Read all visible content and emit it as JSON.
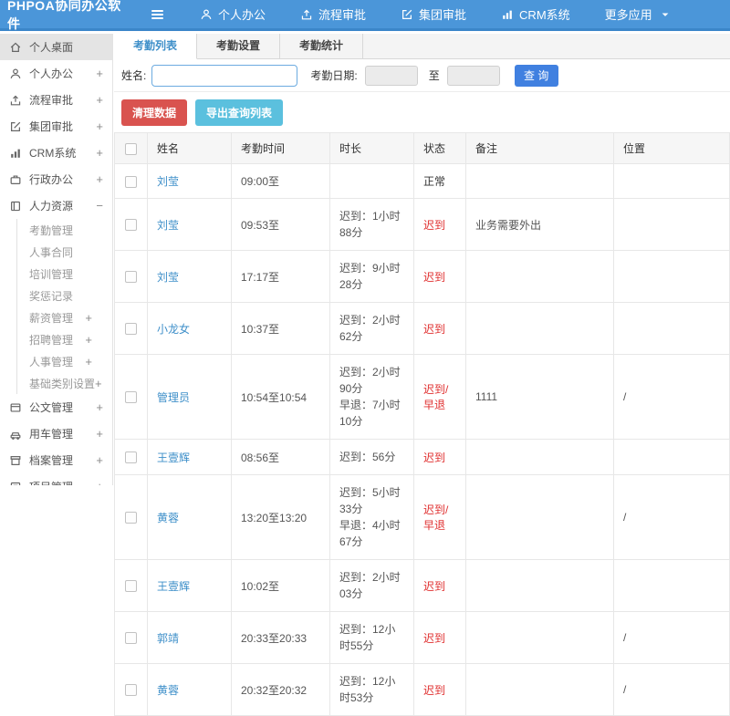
{
  "app": {
    "title": "PHPOA协同办公软件"
  },
  "topnav": {
    "items": [
      {
        "label": "个人办公",
        "icon": "user-icon"
      },
      {
        "label": "流程审批",
        "icon": "flow-icon"
      },
      {
        "label": "集团审批",
        "icon": "edit-icon"
      },
      {
        "label": "CRM系统",
        "icon": "chart-icon"
      },
      {
        "label": "更多应用",
        "icon": "",
        "caret_icon": "caret-down-icon"
      }
    ]
  },
  "sidebar": {
    "items": [
      {
        "label": "个人桌面",
        "icon": "home-icon",
        "type": "main",
        "state": "active",
        "expand": ""
      },
      {
        "label": "个人办公",
        "icon": "user-icon",
        "type": "main",
        "state": "",
        "expand": "+"
      },
      {
        "label": "流程审批",
        "icon": "flow-icon",
        "type": "main",
        "state": "",
        "expand": "+"
      },
      {
        "label": "集团审批",
        "icon": "edit-icon",
        "type": "main",
        "state": "",
        "expand": "+"
      },
      {
        "label": "CRM系统",
        "icon": "chart-icon",
        "type": "main",
        "state": "",
        "expand": "+"
      },
      {
        "label": "行政办公",
        "icon": "briefcase-icon",
        "type": "main",
        "state": "",
        "expand": "+"
      },
      {
        "label": "人力资源",
        "icon": "book-icon",
        "type": "main",
        "state": "",
        "expand": "−"
      },
      {
        "label": "考勤管理",
        "icon": "",
        "type": "sub",
        "state": "",
        "expand": ""
      },
      {
        "label": "人事合同",
        "icon": "",
        "type": "sub",
        "state": "",
        "expand": ""
      },
      {
        "label": "培训管理",
        "icon": "",
        "type": "sub",
        "state": "",
        "expand": ""
      },
      {
        "label": "奖惩记录",
        "icon": "",
        "type": "sub",
        "state": "",
        "expand": ""
      },
      {
        "label": "薪资管理",
        "icon": "",
        "type": "sub",
        "state": "",
        "expand": "+"
      },
      {
        "label": "招聘管理",
        "icon": "",
        "type": "sub",
        "state": "",
        "expand": "+"
      },
      {
        "label": "人事管理",
        "icon": "",
        "type": "sub",
        "state": "",
        "expand": "+"
      },
      {
        "label": "基础类别设置",
        "icon": "",
        "type": "sub",
        "state": "",
        "expand": "+"
      },
      {
        "label": "公文管理",
        "icon": "doc-icon",
        "type": "main",
        "state": "",
        "expand": "+"
      },
      {
        "label": "用车管理",
        "icon": "car-icon",
        "type": "main",
        "state": "",
        "expand": "+"
      },
      {
        "label": "档案管理",
        "icon": "archive-icon",
        "type": "main",
        "state": "",
        "expand": "+"
      },
      {
        "label": "项目管理",
        "icon": "project-icon",
        "type": "main",
        "state": "",
        "expand": "+"
      }
    ]
  },
  "tabs": {
    "items": [
      {
        "label": "考勤列表",
        "state": "active"
      },
      {
        "label": "考勤设置",
        "state": ""
      },
      {
        "label": "考勤统计",
        "state": ""
      }
    ]
  },
  "filter": {
    "name_label": "姓名:",
    "name_value": "",
    "date_label": "考勤日期:",
    "date_from": "",
    "date_to_sep": "至",
    "date_to": "",
    "query_label": "查 询"
  },
  "actions": {
    "clean_label": "清理数据",
    "export_label": "导出查询列表"
  },
  "table": {
    "headers": [
      "姓名",
      "考勤时间",
      "时长",
      "状态",
      "备注",
      "位置"
    ],
    "rows": [
      {
        "name": "刘莹",
        "time": "09:00至",
        "duration1": "",
        "duration2": "",
        "status": "正常",
        "status_type": "normal",
        "remark": "",
        "location": ""
      },
      {
        "name": "刘莹",
        "time": "09:53至",
        "duration1": "迟到：1小时88分",
        "duration2": "",
        "status": "迟到",
        "status_type": "late",
        "remark": "业务需要外出",
        "location": ""
      },
      {
        "name": "刘莹",
        "time": "17:17至",
        "duration1": "迟到：9小时28分",
        "duration2": "",
        "status": "迟到",
        "status_type": "late",
        "remark": "",
        "location": ""
      },
      {
        "name": "小龙女",
        "time": "10:37至",
        "duration1": "迟到：2小时62分",
        "duration2": "",
        "status": "迟到",
        "status_type": "late",
        "remark": "",
        "location": ""
      },
      {
        "name": "管理员",
        "time": "10:54至10:54",
        "duration1": "迟到：2小时90分",
        "duration2": "早退：7小时10分",
        "status": "迟到/早退",
        "status_type": "late",
        "remark": "1111",
        "location": "/"
      },
      {
        "name": "王壹辉",
        "time": "08:56至",
        "duration1": "迟到：56分",
        "duration2": "",
        "status": "迟到",
        "status_type": "late",
        "remark": "",
        "location": ""
      },
      {
        "name": "黄蓉",
        "time": "13:20至13:20",
        "duration1": "迟到：5小时33分",
        "duration2": "早退：4小时67分",
        "status": "迟到/早退",
        "status_type": "late",
        "remark": "",
        "location": "/"
      },
      {
        "name": "王壹辉",
        "time": "10:02至",
        "duration1": "迟到：2小时03分",
        "duration2": "",
        "status": "迟到",
        "status_type": "late",
        "remark": "",
        "location": ""
      },
      {
        "name": "郭靖",
        "time": "20:33至20:33",
        "duration1": "迟到：12小时55分",
        "duration2": "",
        "status": "迟到",
        "status_type": "late",
        "remark": "",
        "location": "/"
      },
      {
        "name": "黄蓉",
        "time": "20:32至20:32",
        "duration1": "迟到：12小时53分",
        "duration2": "",
        "status": "迟到",
        "status_type": "late",
        "remark": "",
        "location": "/"
      }
    ]
  },
  "colors": {
    "header_bg": "#4b96d9",
    "header_border": "#3b86c9",
    "accent": "#3e8fc9",
    "link": "#3e8fc9",
    "red_text": "#e03030",
    "primary": "#4080e0",
    "danger": "#d9534f",
    "info": "#5bc0de",
    "focus_border": "#6cabe0"
  }
}
